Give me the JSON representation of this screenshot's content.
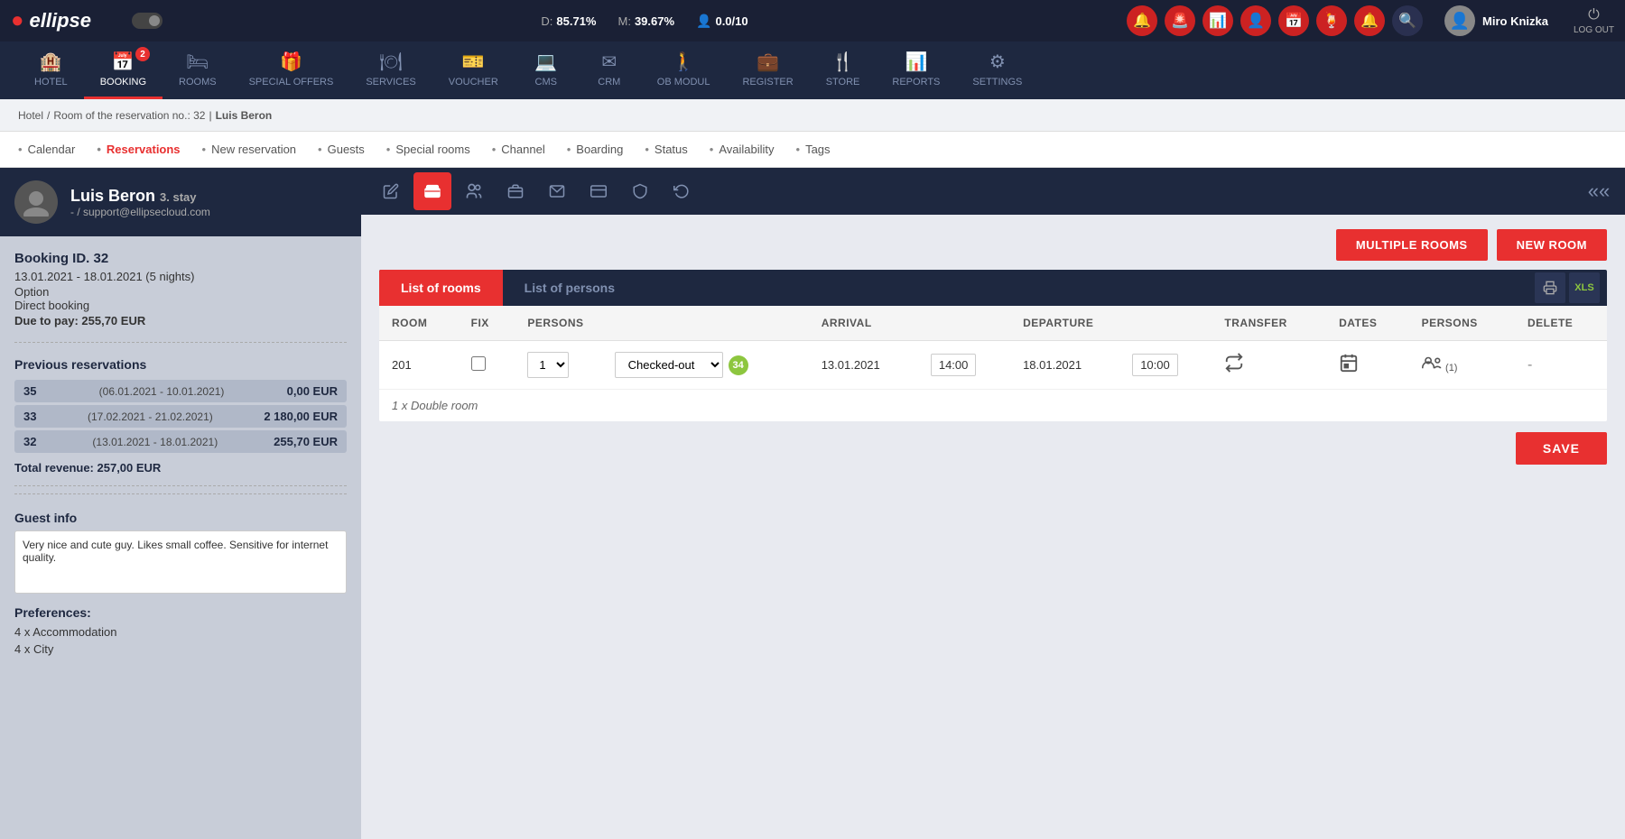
{
  "app": {
    "name": "ellipse",
    "logo_symbol": "○"
  },
  "topbar": {
    "stats": [
      {
        "label": "D:",
        "value": "85.71%"
      },
      {
        "label": "M:",
        "value": "39.67%"
      },
      {
        "label": "⚙",
        "value": "0.0/10"
      }
    ],
    "user": {
      "name": "Miro Knizka",
      "logout_label": "LOG OUT"
    }
  },
  "main_nav": {
    "items": [
      {
        "id": "hotel",
        "label": "HOTEL",
        "icon": "🏨",
        "badge": null,
        "active": false
      },
      {
        "id": "booking",
        "label": "BOOKING",
        "icon": "📅",
        "badge": "2",
        "active": true
      },
      {
        "id": "rooms",
        "label": "ROOMS",
        "icon": "🛏",
        "badge": null,
        "active": false
      },
      {
        "id": "special-offers",
        "label": "SPECIAL OFFERS",
        "icon": "🎁",
        "badge": null,
        "active": false
      },
      {
        "id": "services",
        "label": "SERVICES",
        "icon": "🍽",
        "badge": null,
        "active": false
      },
      {
        "id": "voucher",
        "label": "VOUCHER",
        "icon": "🎫",
        "badge": null,
        "active": false
      },
      {
        "id": "cms",
        "label": "CMS",
        "icon": "💻",
        "badge": null,
        "active": false
      },
      {
        "id": "crm",
        "label": "CRM",
        "icon": "✉",
        "badge": null,
        "active": false
      },
      {
        "id": "ob-modul",
        "label": "OB MODUL",
        "icon": "🚶",
        "badge": null,
        "active": false
      },
      {
        "id": "register",
        "label": "REGISTER",
        "icon": "💼",
        "badge": null,
        "active": false
      },
      {
        "id": "store",
        "label": "STORE",
        "icon": "🍴",
        "badge": null,
        "active": false
      },
      {
        "id": "reports",
        "label": "REPORTS",
        "icon": "📊",
        "badge": null,
        "active": false
      },
      {
        "id": "settings",
        "label": "SETTINGS",
        "icon": "⚙",
        "badge": null,
        "active": false
      }
    ]
  },
  "sub_nav": {
    "items": [
      {
        "label": "Calendar",
        "active": false
      },
      {
        "label": "Reservations",
        "active": true
      },
      {
        "label": "New reservation",
        "active": false
      },
      {
        "label": "Guests",
        "active": false
      },
      {
        "label": "Special rooms",
        "active": false
      },
      {
        "label": "Channel",
        "active": false
      },
      {
        "label": "Boarding",
        "active": false
      },
      {
        "label": "Status",
        "active": false
      },
      {
        "label": "Availability",
        "active": false
      },
      {
        "label": "Tags",
        "active": false
      }
    ]
  },
  "breadcrumb": {
    "parts": [
      "Hotel",
      "Room of the reservation no.: 32",
      "Luis Beron"
    ]
  },
  "sidebar": {
    "guest": {
      "name": "Luis Beron",
      "stay_label": "3. stay",
      "email": "- / support@ellipsecloud.com"
    },
    "booking": {
      "id_label": "Booking ID. 32",
      "dates": "13.01.2021 - 18.01.2021 (5 nights)",
      "option": "Option",
      "direct": "Direct booking",
      "due": "Due to pay: 255,70 EUR"
    },
    "previous_reservations": {
      "title": "Previous reservations",
      "items": [
        {
          "id": "35",
          "dates": "(06.01.2021 - 10.01.2021)",
          "amount": "0,00 EUR"
        },
        {
          "id": "33",
          "dates": "(17.02.2021 - 21.02.2021)",
          "amount": "2 180,00 EUR"
        },
        {
          "id": "32",
          "dates": "(13.01.2021 - 18.01.2021)",
          "amount": "255,70 EUR"
        }
      ],
      "total": "Total revenue: 257,00 EUR"
    },
    "guest_info": {
      "title": "Guest info",
      "text": "Very nice and cute guy. Likes small coffee. Sensitive for internet quality."
    },
    "preferences": {
      "title": "Preferences:",
      "items": [
        "4 x Accommodation",
        "4 x City"
      ]
    }
  },
  "tool_tabs": [
    {
      "id": "edit",
      "icon": "✏",
      "active": false
    },
    {
      "id": "bed",
      "icon": "🛏",
      "active": true
    },
    {
      "id": "persons",
      "icon": "👥",
      "active": false
    },
    {
      "id": "briefcase",
      "icon": "💼",
      "active": false
    },
    {
      "id": "email",
      "icon": "✉",
      "active": false
    },
    {
      "id": "credit-card",
      "icon": "💳",
      "active": false
    },
    {
      "id": "shield",
      "icon": "🛡",
      "active": false
    },
    {
      "id": "refresh",
      "icon": "↺",
      "active": false
    }
  ],
  "action_buttons": {
    "multiple_rooms": "MULTIPLE ROOMS",
    "new_room": "NEW ROOM"
  },
  "tabs": {
    "items": [
      {
        "id": "list-of-rooms",
        "label": "List of rooms",
        "active": true
      },
      {
        "id": "list-of-persons",
        "label": "List of persons",
        "active": false
      }
    ]
  },
  "table": {
    "headers": [
      "ROOM",
      "FIX",
      "PERSONS",
      "",
      "ARRIVAL",
      "",
      "DEPARTURE",
      "",
      "TRANSFER",
      "DATES",
      "PERSONS",
      "DELETE"
    ],
    "rows": [
      {
        "room": "201",
        "fix": false,
        "persons_value": "1",
        "status": "Checked-out",
        "status_badge": "34",
        "arrival_date": "13.01.2021",
        "arrival_time": "14:00",
        "departure_date": "18.01.2021",
        "departure_time": "10:00",
        "persons_count": "(1)",
        "delete": "-"
      }
    ],
    "room_type_note": "1 x Double room"
  },
  "save_btn": "SAVE"
}
